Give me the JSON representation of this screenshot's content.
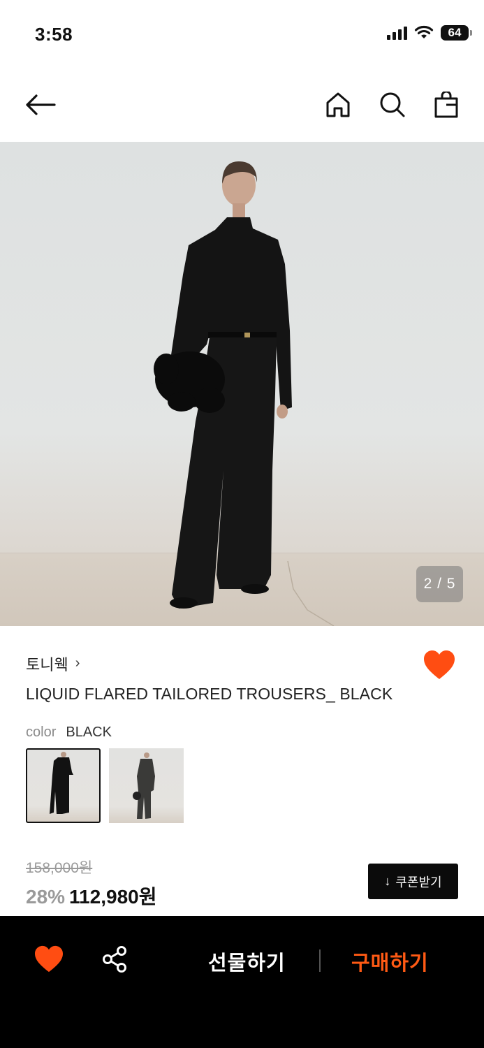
{
  "status_bar": {
    "time": "3:58",
    "battery": "64"
  },
  "nav": {
    "icons": [
      "back-arrow-icon",
      "home-icon",
      "search-icon",
      "shopping-bag-icon"
    ]
  },
  "hero": {
    "page_indicator": "2 / 5",
    "current_page": 2,
    "total_pages": 5
  },
  "product": {
    "brand": "토니웩",
    "brand_chevron": "›",
    "title": "LIQUID FLARED TAILORED TROUSERS_ BLACK",
    "wishlisted": true,
    "color_label": "color",
    "color_value": "BLACK",
    "swatch_count": 2,
    "selected_swatch": 0
  },
  "price": {
    "original": "158,000원",
    "discount": "28%",
    "final": "112,980원",
    "coupon_button": "쿠폰받기",
    "coupon_icon": "↓"
  },
  "bottom_bar": {
    "gift_label": "선물하기",
    "buy_label": "구매하기"
  },
  "colors": {
    "accent": "#ff5a14",
    "heart": "#ff4d12",
    "bar_bg": "#000000"
  }
}
